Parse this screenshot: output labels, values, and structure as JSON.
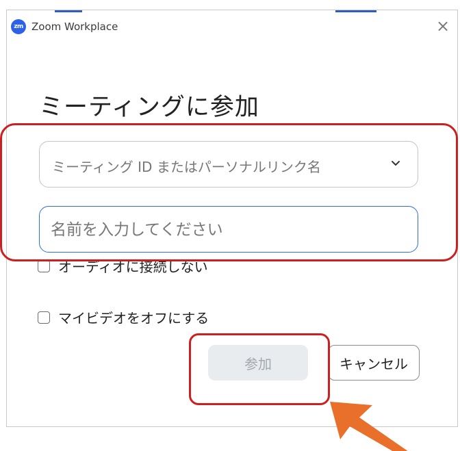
{
  "window": {
    "app_logo_text": "zm",
    "title": "Zoom Workplace",
    "close_glyph": "×"
  },
  "dialog": {
    "heading": "ミーティングに参加",
    "meeting_id_placeholder": "ミーティング ID またはパーソナルリンク名",
    "name_placeholder": "名前を入力してください",
    "options": [
      {
        "label": "オーディオに接続しない",
        "checked": false
      },
      {
        "label": "マイビデオをオフにする",
        "checked": false
      }
    ],
    "join_label": "参加",
    "cancel_label": "キャンセル"
  },
  "icons": {
    "dropdown": "chevron-down-icon",
    "close": "close-icon"
  },
  "colors": {
    "accent": "#2b6ee0",
    "annotation": "#cc1f1f",
    "arrow": "#e8702a",
    "join_disabled_bg": "#e9ecef"
  }
}
